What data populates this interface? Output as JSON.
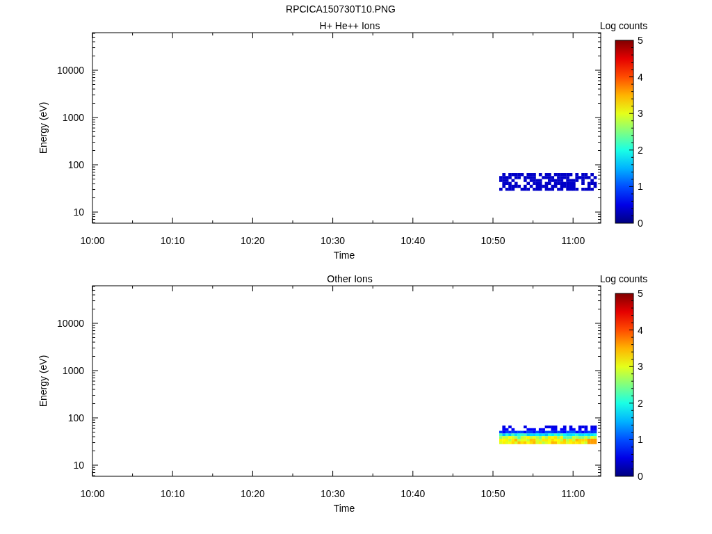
{
  "title": "RPCICA150730T10.PNG",
  "panels": [
    {
      "kind": "sparse",
      "title": "H+ He++ Ions",
      "ylabel": "Energy (eV)",
      "xlabel": "Time",
      "yticks": [
        "10000",
        "1000",
        "100",
        "10"
      ],
      "xticks": [
        "10:00",
        "10:10",
        "10:20",
        "10:30",
        "10:40",
        "10:50",
        "11:00"
      ],
      "colorbar": {
        "title": "Log counts",
        "ticks": [
          "5",
          "4",
          "3",
          "2",
          "1",
          "0"
        ]
      }
    },
    {
      "kind": "layered",
      "title": "Other Ions",
      "ylabel": "Energy (eV)",
      "xlabel": "Time",
      "yticks": [
        "10000",
        "1000",
        "100",
        "10"
      ],
      "xticks": [
        "10:00",
        "10:10",
        "10:20",
        "10:30",
        "10:40",
        "10:50",
        "11:00"
      ],
      "colorbar": {
        "title": "Log counts",
        "ticks": [
          "5",
          "4",
          "3",
          "2",
          "1",
          "0"
        ]
      }
    }
  ]
}
